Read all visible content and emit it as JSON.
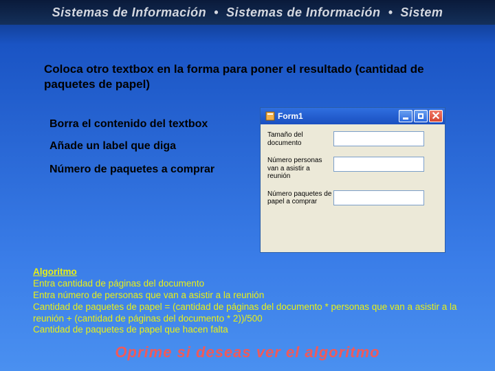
{
  "banner": {
    "text_a": "Sistemas de Información",
    "text_b": "Sistemas de Información",
    "text_c": "Sistem"
  },
  "instruction": "Coloca otro textbox en la forma para poner el resultado (cantidad de paquetes de papel)",
  "bullets": {
    "b1": "Borra el contenido del textbox",
    "b2": "Añade un label que diga",
    "b3": "Número de paquetes a comprar"
  },
  "form": {
    "title": "Form1",
    "label1": "Tamaño del documento",
    "label2": "Número personas van a asistir a reunión",
    "label3": "Número paquetes de papel a comprar"
  },
  "algo": {
    "header": "Algoritmo",
    "l1": "Entra cantidad de páginas del documento",
    "l2": "Entra número de personas que van a  asistir a la reunión",
    "l3": "Cantidad de paquetes de papel = (cantidad de páginas del documento * personas que van a asistir a la reunión  + (cantidad de páginas del documento * 2))/500",
    "l4": "Cantidad de paquetes de papel que hacen falta"
  },
  "cta": "Oprime  si deseas ver el algoritmo"
}
